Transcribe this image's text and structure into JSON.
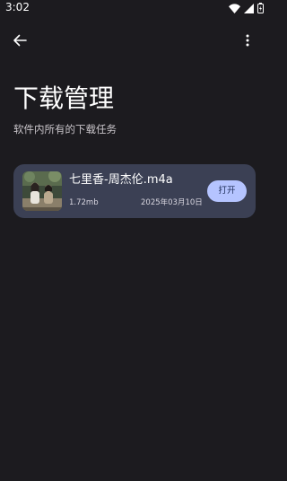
{
  "status_bar": {
    "time": "3:02",
    "icons": [
      "wifi-icon",
      "signal-icon",
      "battery-icon"
    ]
  },
  "toolbar": {
    "back_icon": "arrow-back-icon",
    "more_icon": "more-vert-icon"
  },
  "header": {
    "title": "下载管理",
    "subtitle": "软件内所有的下载任务"
  },
  "downloads": [
    {
      "name": "七里香-周杰伦.m4a",
      "size": "1.72mb",
      "date": "2025年03月10日",
      "action_label": "打开"
    }
  ],
  "colors": {
    "background": "#1c1b1f",
    "card": "#3b4054",
    "accent_button": "#b5c4ff"
  }
}
